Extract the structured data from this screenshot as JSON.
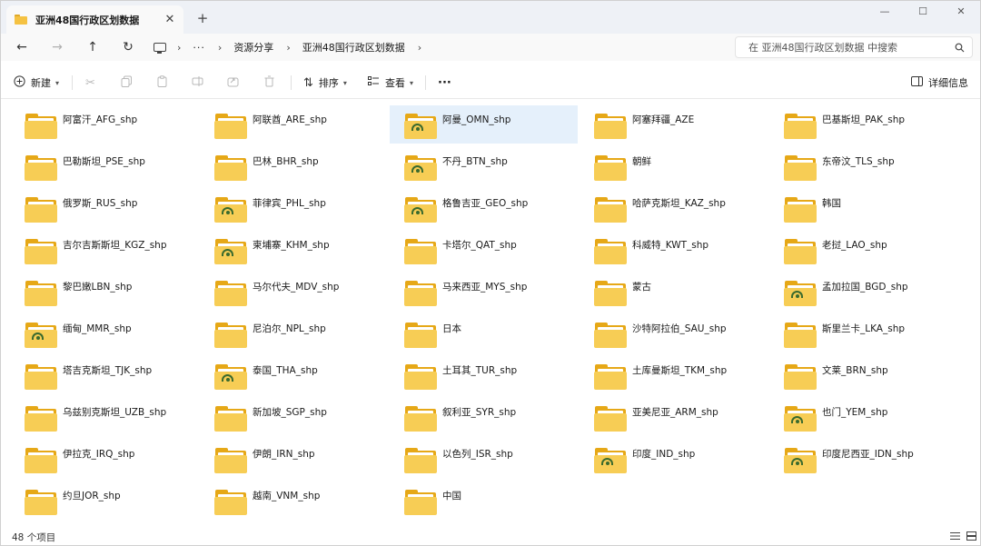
{
  "window": {
    "tab_title": "亚洲48国行政区划数据",
    "tab_icon": "folder-icon",
    "new_tab_symbol": "+",
    "close_symbol": "✕"
  },
  "controls": {
    "minimize": "—",
    "maximize": "☐",
    "close": "✕"
  },
  "nav": {
    "back": "←",
    "forward": "→",
    "up": "↑",
    "refresh": "↻"
  },
  "breadcrumb": {
    "sep": "›",
    "more": "···",
    "items": [
      "资源分享",
      "亚洲48国行政区划数据"
    ]
  },
  "search": {
    "placeholder": "在 亚洲48国行政区划数据 中搜索",
    "icon": "search-icon"
  },
  "commands": {
    "new": "新建",
    "sort": "排序",
    "view": "查看",
    "more": "···",
    "details": "详细信息"
  },
  "items": [
    [
      "阿富汗_AFG_shp",
      "阿联酋_ARE_shp",
      "阿曼_OMN_shp",
      "阿塞拜疆_AZE",
      "巴基斯坦_PAK_shp"
    ],
    [
      "巴勒斯坦_PSE_shp",
      "巴林_BHR_shp",
      "不丹_BTN_shp",
      "朝鲜",
      "东帝汶_TLS_shp"
    ],
    [
      "俄罗斯_RUS_shp",
      "菲律宾_PHL_shp",
      "格鲁吉亚_GEO_shp",
      "哈萨克斯坦_KAZ_shp",
      "韩国"
    ],
    [
      "吉尔吉斯斯坦_KGZ_shp",
      "柬埔寨_KHM_shp",
      "卡塔尔_QAT_shp",
      "科威特_KWT_shp",
      "老挝_LAO_shp"
    ],
    [
      "黎巴嫩LBN_shp",
      "马尔代夫_MDV_shp",
      "马来西亚_MYS_shp",
      "蒙古",
      "孟加拉国_BGD_shp"
    ],
    [
      "缅甸_MMR_shp",
      "尼泊尔_NPL_shp",
      "日本",
      "沙特阿拉伯_SAU_shp",
      "斯里兰卡_LKA_shp"
    ],
    [
      "塔吉克斯坦_TJK_shp",
      "泰国_THA_shp",
      "土耳其_TUR_shp",
      "土库曼斯坦_TKM_shp",
      "文莱_BRN_shp"
    ],
    [
      "乌兹别克斯坦_UZB_shp",
      "新加坡_SGP_shp",
      "叙利亚_SYR_shp",
      "亚美尼亚_ARM_shp",
      "也门_YEM_shp"
    ],
    [
      "伊拉克_IRQ_shp",
      "伊朗_IRN_shp",
      "以色列_ISR_shp",
      "印度_IND_shp",
      "印度尼西亚_IDN_shp"
    ],
    [
      "约旦JOR_shp",
      "越南_VNM_shp",
      "中国"
    ]
  ],
  "status": {
    "count": "48 个项目"
  },
  "colors": {
    "folder_front": "#f7cd55",
    "folder_back": "#e6a817",
    "selection": "#e5f0fb",
    "titlebar": "#eef1f6"
  }
}
